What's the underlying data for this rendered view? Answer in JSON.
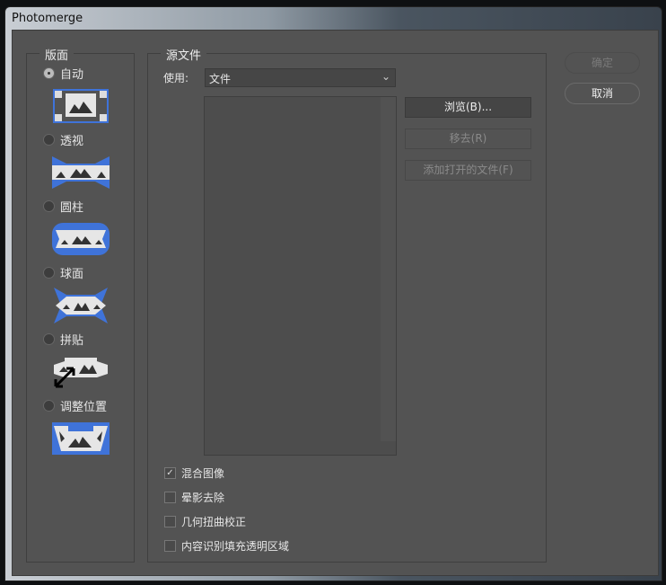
{
  "window": {
    "title": "Photomerge"
  },
  "layout_panel": {
    "legend": "版面",
    "options": [
      {
        "label": "自动",
        "selected": true,
        "icon": "auto-layout-icon"
      },
      {
        "label": "透视",
        "selected": false,
        "icon": "perspective-layout-icon"
      },
      {
        "label": "圆柱",
        "selected": false,
        "icon": "cylindrical-layout-icon"
      },
      {
        "label": "球面",
        "selected": false,
        "icon": "spherical-layout-icon"
      },
      {
        "label": "拼贴",
        "selected": false,
        "icon": "collage-layout-icon"
      },
      {
        "label": "调整位置",
        "selected": false,
        "icon": "reposition-layout-icon"
      }
    ]
  },
  "source": {
    "legend": "源文件",
    "use_label": "使用:",
    "use_value": "文件",
    "browse": "浏览(B)...",
    "remove": "移去(R)",
    "add_open": "添加打开的文件(F)",
    "checkboxes": [
      {
        "label": "混合图像",
        "checked": true
      },
      {
        "label": "晕影去除",
        "checked": false
      },
      {
        "label": "几何扭曲校正",
        "checked": false
      },
      {
        "label": "内容识别填充透明区域",
        "checked": false
      }
    ]
  },
  "actions": {
    "ok": "确定",
    "cancel": "取消"
  },
  "colors": {
    "accent": "#3f73d9",
    "panel": "#535353"
  }
}
